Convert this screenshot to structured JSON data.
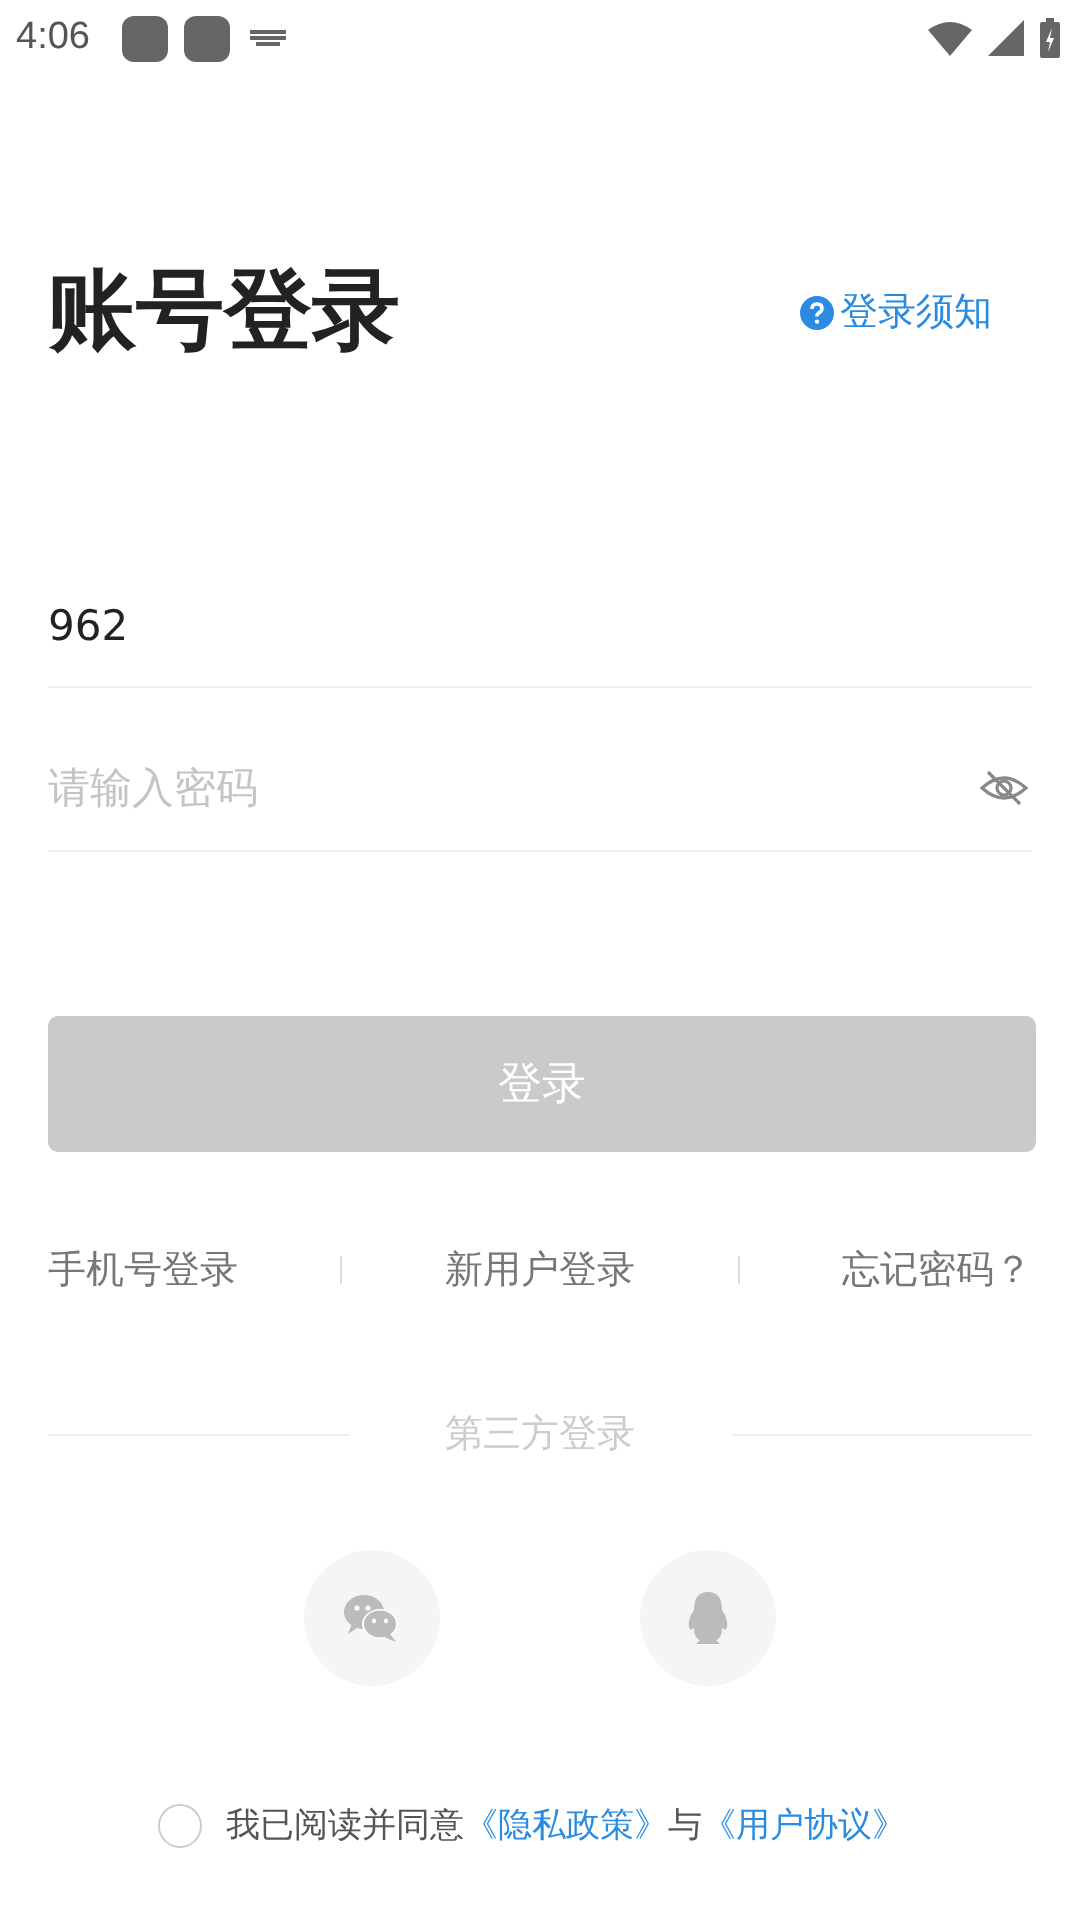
{
  "status_bar": {
    "time": "4:06"
  },
  "title": "账号登录",
  "help_link": "登录须知",
  "phone_field": {
    "value": "962"
  },
  "password_field": {
    "placeholder": "请输入密码",
    "visible": false
  },
  "login_button": {
    "label": "登录",
    "disabled": true
  },
  "links": [
    "手机号登录",
    "新用户登录",
    "忘记密码？"
  ],
  "third_party": {
    "label": "第三方登录"
  },
  "agreement": {
    "checked": false,
    "parts": [
      {
        "kind": "text",
        "text": "我已阅读并同意"
      },
      {
        "kind": "link",
        "text": "《隐私政策》"
      },
      {
        "kind": "text",
        "text": "与"
      },
      {
        "kind": "link",
        "text": "《用户协议》"
      }
    ]
  }
}
